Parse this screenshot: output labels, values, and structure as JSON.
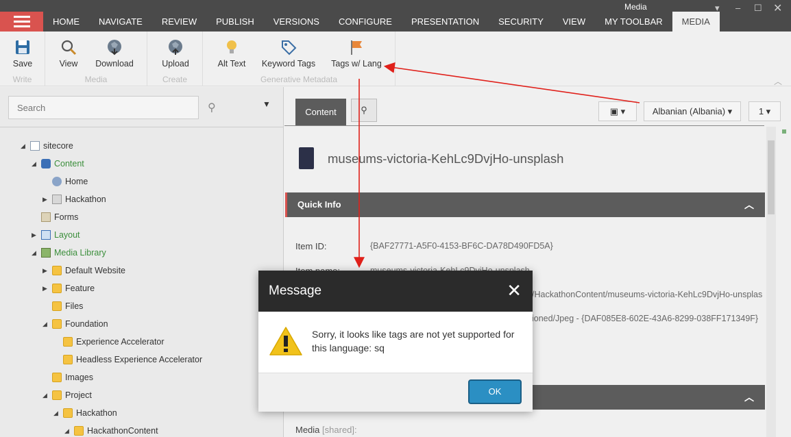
{
  "topbar": {
    "tabs": [
      {
        "label": "HOME"
      },
      {
        "label": "NAVIGATE"
      },
      {
        "label": "REVIEW"
      },
      {
        "label": "PUBLISH"
      },
      {
        "label": "VERSIONS"
      },
      {
        "label": "CONFIGURE"
      },
      {
        "label": "PRESENTATION"
      },
      {
        "label": "SECURITY"
      },
      {
        "label": "VIEW"
      },
      {
        "label": "MY TOOLBAR"
      },
      {
        "label": "MEDIA"
      }
    ],
    "context_label": "Media"
  },
  "ribbon": {
    "groups": [
      {
        "label": "Write",
        "buttons": [
          {
            "label": "Save",
            "icon": "save-icon"
          }
        ]
      },
      {
        "label": "Media",
        "buttons": [
          {
            "label": "View",
            "icon": "magnifier-icon"
          },
          {
            "label": "Download",
            "icon": "download-globe-icon"
          }
        ]
      },
      {
        "label": "Create",
        "buttons": [
          {
            "label": "Upload",
            "icon": "upload-globe-icon"
          }
        ]
      },
      {
        "label": "Generative Metadata",
        "buttons": [
          {
            "label": "Alt Text",
            "icon": "lightbulb-icon"
          },
          {
            "label": "Keyword Tags",
            "icon": "tag-icon"
          },
          {
            "label": "Tags w/ Lang",
            "icon": "flag-icon"
          }
        ]
      }
    ]
  },
  "tree": {
    "search_placeholder": "Search",
    "nodes": [
      {
        "label": "sitecore"
      },
      {
        "label": "Content"
      },
      {
        "label": "Home"
      },
      {
        "label": "Hackathon"
      },
      {
        "label": "Forms"
      },
      {
        "label": "Layout"
      },
      {
        "label": "Media Library"
      },
      {
        "label": "Default Website"
      },
      {
        "label": "Feature"
      },
      {
        "label": "Files"
      },
      {
        "label": "Foundation"
      },
      {
        "label": "Experience Accelerator"
      },
      {
        "label": "Headless Experience Accelerator"
      },
      {
        "label": "Images"
      },
      {
        "label": "Project"
      },
      {
        "label": "Hackathon"
      },
      {
        "label": "HackathonContent"
      }
    ]
  },
  "editor": {
    "content_tab": "Content",
    "language": "Albanian (Albania)",
    "version": "1",
    "item_title": "museums-victoria-KehLc9DvjHo-unsplash",
    "quick_info": "Quick Info",
    "fields": {
      "item_id_label": "Item ID:",
      "item_id_value": "{BAF27771-A5F0-4153-BF6C-DA78D490FD5A}",
      "item_name_label": "Item name:",
      "item_name_value": "museums-victoria-KehLc9DvjHo-unsplash",
      "path_value": "/HackathonContent/museums-victoria-KehLc9DvjHo-unsplas",
      "template_value": "ioned/Jpeg - {DAF085E8-602E-43A6-8299-038FF171349F}"
    },
    "media_label": "Media",
    "media_shared": "[shared]:"
  },
  "modal": {
    "title": "Message",
    "text": "Sorry, it looks like tags are not yet supported for this language: sq",
    "ok": "OK"
  },
  "colors": {
    "accent_red": "#d9534f",
    "topbar": "#4a4a4a",
    "section": "#5c5c5c",
    "ok_button": "#2b8fc3",
    "annotation_arrow": "#e0201a"
  }
}
